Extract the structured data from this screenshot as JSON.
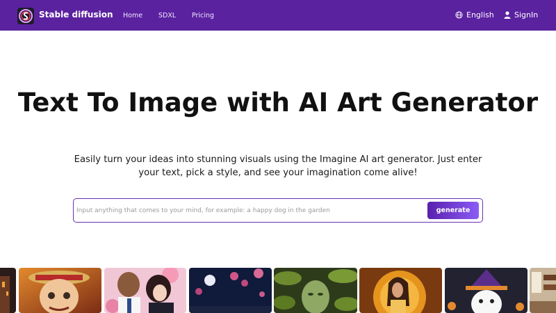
{
  "navbar": {
    "brand": "Stable diffusion",
    "logo_icon": "stable-diffusion-logo-icon",
    "links": [
      "Home",
      "SDXL",
      "Pricing"
    ],
    "language": "English",
    "language_icon": "globe-icon",
    "signin": "SignIn",
    "signin_icon": "user-icon",
    "color": "#5b22a0"
  },
  "hero": {
    "title": "Text To Image with AI Art Generator",
    "subtitle": "Easily turn your ideas into stunning visuals using the Imagine AI art generator. Just enter your text, pick a style, and see your imagination come alive!"
  },
  "search": {
    "placeholder": "Input anything that comes to your mind, for example: a happy dog in the garden",
    "value": "",
    "button": "generate"
  },
  "gallery": {
    "items": [
      "castle-night-image",
      "anime-pirate-boy-image",
      "anime-couple-image",
      "night-blossom-image",
      "leaf-face-image",
      "golden-woman-image",
      "halloween-ghost-image",
      "library-room-image"
    ]
  }
}
